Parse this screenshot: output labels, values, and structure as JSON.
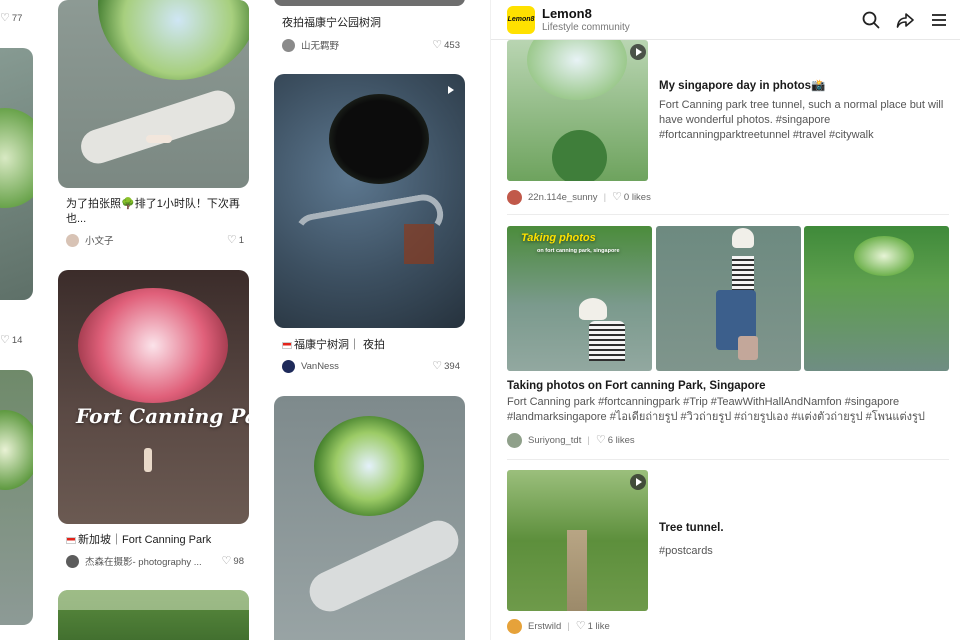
{
  "left_feed": {
    "edge_col": {
      "likes_top": "77",
      "likes_mid": "14"
    },
    "col1": [
      {
        "caption": "为了拍张照🌳排了1小时队！下次再也...",
        "author": "小文子",
        "likes": "1"
      },
      {
        "overlay": "Fort Canning Park",
        "caption": "新加坡｜Fort Canning Park",
        "author": "杰森在摄影- photography ...",
        "likes": "98"
      }
    ],
    "col2": [
      {
        "caption": "夜拍福康宁公园树洞",
        "author": "山无羁野",
        "likes": "453"
      },
      {
        "caption": "福康宁树洞｜ 夜拍",
        "author": "VanNess",
        "likes": "394"
      }
    ]
  },
  "app": {
    "logo_text": "Lemon8",
    "title": "Lemon8",
    "subtitle": "Lifestyle community",
    "accent": "#ffe100"
  },
  "posts": [
    {
      "title": "My singapore day in photos📸",
      "body": "Fort Canning park tree tunnel, such a normal place but will have wonderful photos. #singapore #fortcanningparktreetunnel #travel #citywalk",
      "author": "22n.114e_sunny",
      "likes": "0 likes"
    },
    {
      "overlay_title": "Taking photos",
      "overlay_sub": "on fort canning park, singapore",
      "title": "Taking photos on Fort canning Park, Singapore",
      "body": "Fort Canning park #fortcanningpark #Trip #TeawWithHallAndNamfon #singapore #landmarksingapore #ไอเดียถ่ายรูป #วิวถ่ายรูป #ถ่ายรูปเอง #แต่งตัวถ่ายรูป #โพนแต่งรูป",
      "author": "Suriyong_tdt",
      "likes": "6 likes"
    },
    {
      "title": "Tree tunnel.",
      "body": "#postcards",
      "author": "Erstwild",
      "likes": "1 like"
    }
  ],
  "colors": {
    "foliage": "#4d8a3c",
    "stone": "#7d8a8f",
    "pink_tree": "#e0607a"
  }
}
